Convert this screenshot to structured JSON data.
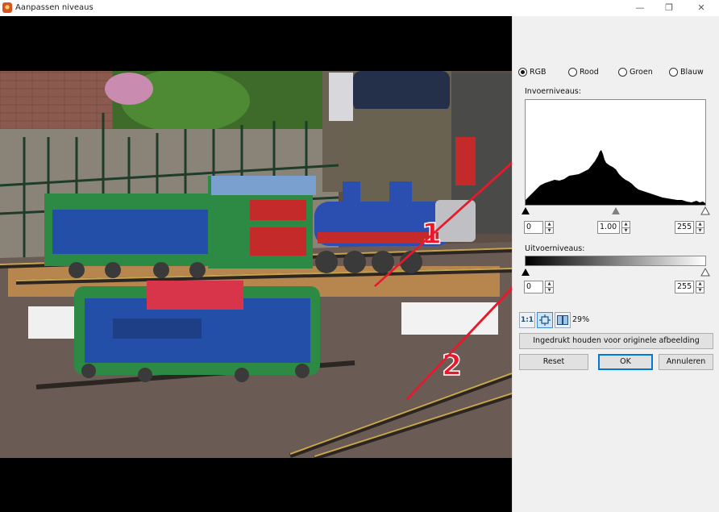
{
  "window": {
    "title": "Aanpassen niveaus",
    "minimize_glyph": "—",
    "maximize_glyph": "❐",
    "close_glyph": "✕"
  },
  "preview": {
    "annotation_1": "1",
    "annotation_2": "2",
    "annotation_color": "#e8192c"
  },
  "channels": {
    "selected": "RGB",
    "options": [
      "RGB",
      "Rood",
      "Groen",
      "Blauw"
    ]
  },
  "input_levels": {
    "label": "Invoerniveaus:",
    "black": "0",
    "gamma": "1.00",
    "white": "255"
  },
  "output_levels": {
    "label": "Uitvoerniveaus:",
    "black": "0",
    "white": "255"
  },
  "zoom": {
    "one_to_one_label": "1:1",
    "fit_icon": "fit-to-window-icon",
    "split_icon": "split-view-icon",
    "percent": "29%"
  },
  "buttons": {
    "hold": "Ingedrukt houden voor originele afbeelding",
    "reset": "Reset",
    "ok": "OK",
    "cancel": "Annuleren"
  },
  "colors": {
    "accent": "#0078d7",
    "histogram": "#000000"
  }
}
